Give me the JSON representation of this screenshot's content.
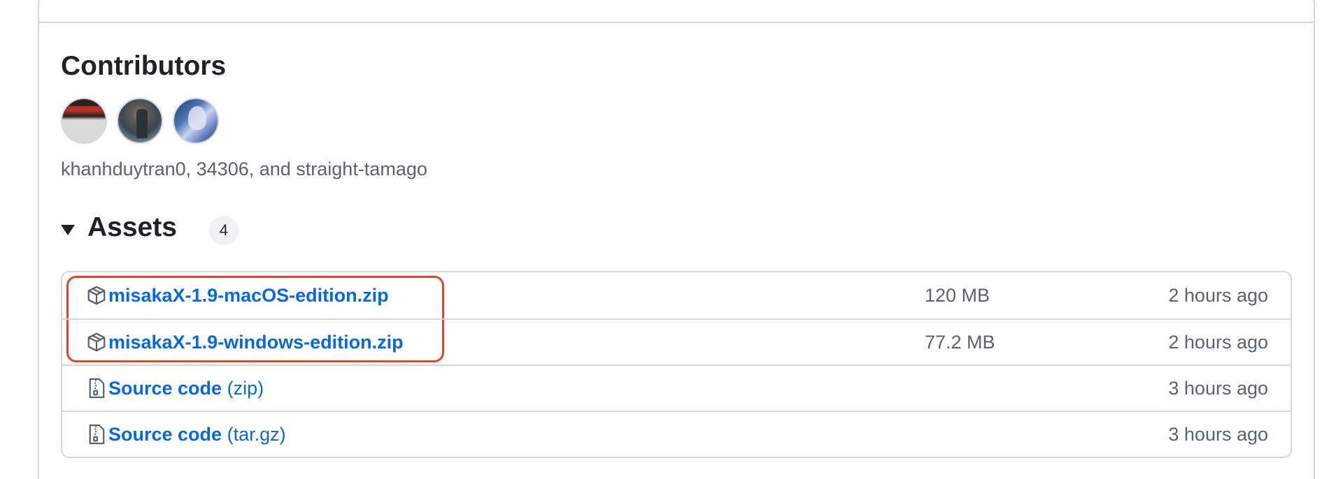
{
  "contributors": {
    "title": "Contributors",
    "names": "khanhduytran0, 34306, and straight-tamago",
    "avatars": [
      "khanhduytran0",
      "34306",
      "straight-tamago"
    ]
  },
  "assets": {
    "title": "Assets",
    "count": "4",
    "items": [
      {
        "name": "misakaX-1.9-macOS-edition.zip",
        "suffix": "",
        "size": "120 MB",
        "time": "2 hours ago",
        "icon": "package-icon"
      },
      {
        "name": "misakaX-1.9-windows-edition.zip",
        "suffix": "",
        "size": "77.2 MB",
        "time": "2 hours ago",
        "icon": "package-icon"
      },
      {
        "name": "Source code",
        "suffix": "(zip)",
        "size": "",
        "time": "3 hours ago",
        "icon": "file-zip-icon"
      },
      {
        "name": "Source code",
        "suffix": "(tar.gz)",
        "size": "",
        "time": "3 hours ago",
        "icon": "file-zip-icon"
      }
    ]
  },
  "colors": {
    "link": "#0969da",
    "muted": "#59636e",
    "border": "#d0d7de",
    "highlight": "#e0452b"
  }
}
